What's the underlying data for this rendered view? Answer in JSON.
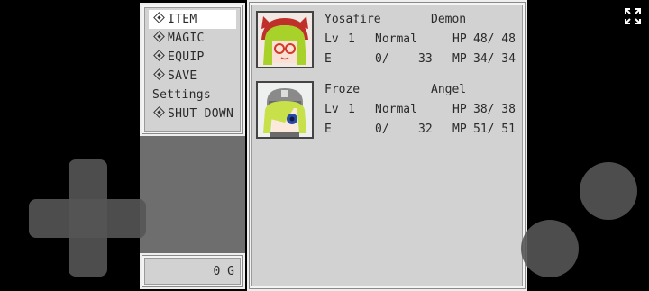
{
  "menu": {
    "items": [
      {
        "label": "ITEM",
        "icon": "diamond-icon",
        "selected": true
      },
      {
        "label": "MAGIC",
        "icon": "diamond-icon"
      },
      {
        "label": "EQUIP",
        "icon": "diamond-icon"
      },
      {
        "label": "SAVE",
        "icon": "diamond-icon"
      },
      {
        "label": "Settings",
        "icon": ""
      },
      {
        "label": "SHUT DOWN",
        "icon": "diamond-icon"
      }
    ]
  },
  "gold": {
    "label": "0 G"
  },
  "party": [
    {
      "name": "Yosafire",
      "class": "Demon",
      "level_label": "Lv",
      "level": "1",
      "state": "Normal",
      "hp_label": "HP",
      "hp": "48/ 48",
      "e_label": "E",
      "exp": "0/",
      "exp_next": "33",
      "mp_label": "MP",
      "mp": "34/ 34",
      "hair_color": "#a8d22a",
      "hat_color": "#c0302a"
    },
    {
      "name": "Froze",
      "class": "Angel",
      "level_label": "Lv",
      "level": "1",
      "state": "Normal",
      "hp_label": "HP",
      "hp": "38/ 38",
      "e_label": "E",
      "exp": "0/",
      "exp_next": "32",
      "mp_label": "MP",
      "mp": "51/ 51",
      "hair_color": "#c8e04a",
      "hat_color": "#8a8a8a"
    }
  ],
  "colors": {
    "window": "#d2d2d2",
    "border": "#eeeeee",
    "controls": "#555555"
  }
}
